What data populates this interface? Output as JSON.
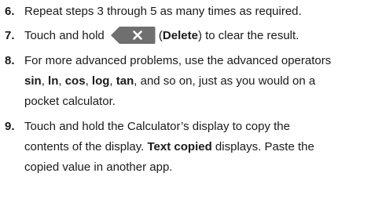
{
  "steps": [
    {
      "number": "6.",
      "text": "Repeat steps 3 through 5 as many times as required."
    },
    {
      "number": "7.",
      "before": "Touch and hold",
      "paren_open": "(",
      "bold": "Delete",
      "paren_close": ") to clear the result.",
      "icon": "delete-key-icon"
    },
    {
      "number": "8.",
      "line1": "For more advanced problems, use the advanced operators",
      "ops": [
        "sin",
        "ln",
        "cos",
        "log",
        "tan"
      ],
      "sep": ", ",
      "ops_tail": ", and so on, just as you would on a",
      "line3": "pocket calculator."
    },
    {
      "number": "9.",
      "line1": "Touch and hold the Calculator’s display to copy the",
      "line2_start": "contents of the display.",
      "bold": "Text copied",
      "line2_end": "displays. Paste the",
      "line3": "copied value in another app."
    }
  ],
  "colors": {
    "text": "#1a1a1a",
    "key_bg": "#6f6f6f",
    "key_glyph": "#ffffff"
  }
}
